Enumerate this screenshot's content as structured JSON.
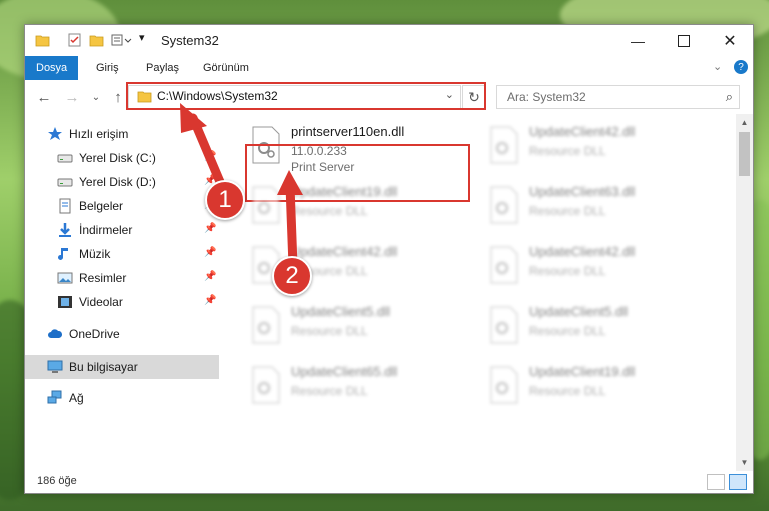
{
  "window": {
    "title": "System32"
  },
  "ribbon": {
    "tabs": [
      {
        "label": "Dosya",
        "active": true
      },
      {
        "label": "Giriş",
        "active": false
      },
      {
        "label": "Paylaş",
        "active": false
      },
      {
        "label": "Görünüm",
        "active": false
      }
    ]
  },
  "nav": {
    "address": "C:\\Windows\\System32",
    "search_placeholder": "Ara: System32"
  },
  "sidebar": {
    "items": [
      {
        "label": "Hızlı erişim",
        "icon": "star-icon",
        "pinned": false
      },
      {
        "label": "Yerel Disk (C:)",
        "icon": "drive-icon",
        "pinned": true
      },
      {
        "label": "Yerel Disk (D:)",
        "icon": "drive-icon",
        "pinned": true
      },
      {
        "label": "Belgeler",
        "icon": "documents-icon",
        "pinned": true
      },
      {
        "label": "İndirmeler",
        "icon": "download-icon",
        "pinned": true
      },
      {
        "label": "Müzik",
        "icon": "music-icon",
        "pinned": true
      },
      {
        "label": "Resimler",
        "icon": "pictures-icon",
        "pinned": true
      },
      {
        "label": "Videolar",
        "icon": "videos-icon",
        "pinned": true
      },
      {
        "label": "OneDrive",
        "icon": "cloud-icon",
        "pinned": false
      },
      {
        "label": "Bu bilgisayar",
        "icon": "computer-icon",
        "pinned": false,
        "selected": true
      },
      {
        "label": "Ağ",
        "icon": "network-icon",
        "pinned": false
      }
    ]
  },
  "files": {
    "featured": {
      "name": "printserver110en.dll",
      "version": "11.0.0.233",
      "description": "Print Server"
    },
    "items": [
      {
        "name": "UpdateClient42.dll",
        "description": "Resource DLL"
      },
      {
        "name": "UpdateClient19.dll",
        "description": "Resource DLL"
      },
      {
        "name": "UpdateClient63.dll",
        "description": "Resource DLL"
      },
      {
        "name": "UpdateClient42.dll",
        "description": "Resource DLL"
      },
      {
        "name": "UpdateClient42.dll",
        "description": "Resource DLL"
      },
      {
        "name": "UpdateClient5.dll",
        "description": "Resource DLL"
      },
      {
        "name": "UpdateClient5.dll",
        "description": "Resource DLL"
      },
      {
        "name": "UpdateClient65.dll",
        "description": "Resource DLL"
      },
      {
        "name": "UpdateClient19.dll",
        "description": "Resource DLL"
      }
    ]
  },
  "status": {
    "item_count": "186 öğe"
  },
  "annotations": {
    "step1": "1",
    "step2": "2"
  },
  "colors": {
    "accent": "#1979ca",
    "highlight": "#d9372f"
  }
}
